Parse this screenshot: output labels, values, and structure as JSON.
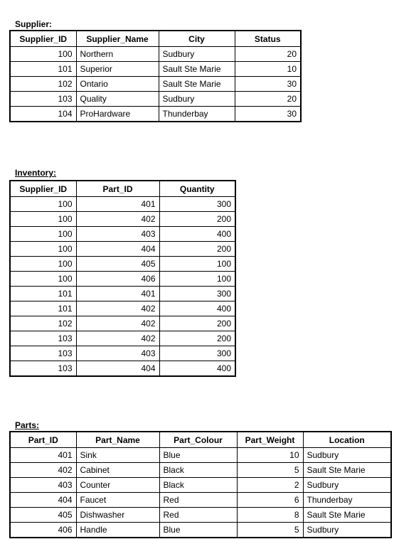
{
  "supplier": {
    "title": "Supplier:",
    "columns": [
      "Supplier_ID",
      "Supplier_Name",
      "City",
      "Status"
    ],
    "rows": [
      [
        "100",
        "Northern",
        "Sudbury",
        "20"
      ],
      [
        "101",
        "Superior",
        "Sault Ste Marie",
        "10"
      ],
      [
        "102",
        "Ontario",
        "Sault Ste Marie",
        "30"
      ],
      [
        "103",
        "Quality",
        "Sudbury",
        "20"
      ],
      [
        "104",
        "ProHardware",
        "Thunderbay",
        "30"
      ]
    ]
  },
  "inventory": {
    "title": "Inventory:",
    "columns": [
      "Supplier_ID",
      "Part_ID",
      "Quantity"
    ],
    "rows": [
      [
        "100",
        "401",
        "300"
      ],
      [
        "100",
        "402",
        "200"
      ],
      [
        "100",
        "403",
        "400"
      ],
      [
        "100",
        "404",
        "200"
      ],
      [
        "100",
        "405",
        "100"
      ],
      [
        "100",
        "406",
        "100"
      ],
      [
        "101",
        "401",
        "300"
      ],
      [
        "101",
        "402",
        "400"
      ],
      [
        "102",
        "402",
        "200"
      ],
      [
        "103",
        "402",
        "200"
      ],
      [
        "103",
        "403",
        "300"
      ],
      [
        "103",
        "404",
        "400"
      ]
    ]
  },
  "parts": {
    "title": "Parts:",
    "columns": [
      "Part_ID",
      "Part_Name",
      "Part_Colour",
      "Part_Weight",
      "Location"
    ],
    "rows": [
      [
        "401",
        "Sink",
        "Blue",
        "10",
        "Sudbury"
      ],
      [
        "402",
        "Cabinet",
        "Black",
        "5",
        "Sault Ste Marie"
      ],
      [
        "403",
        "Counter",
        "Black",
        "2",
        "Sudbury"
      ],
      [
        "404",
        "Faucet",
        "Red",
        "6",
        "Thunderbay"
      ],
      [
        "405",
        "Dishwasher",
        "Red",
        "8",
        "Sault Ste Marie"
      ],
      [
        "406",
        "Handle",
        "Blue",
        "5",
        "Sudbury"
      ]
    ]
  }
}
